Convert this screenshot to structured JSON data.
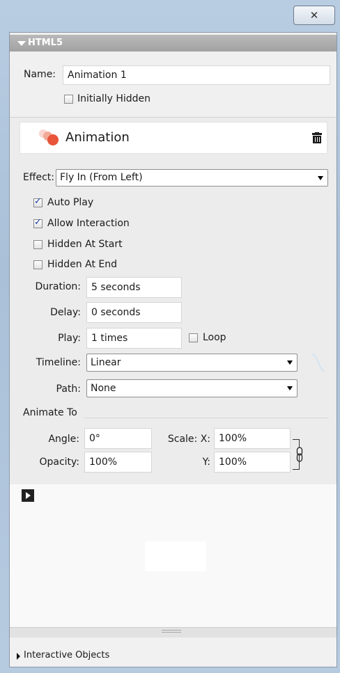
{
  "window": {
    "close_glyph": "✕"
  },
  "html5_section": {
    "title": "HTML5",
    "name_label": "Name:",
    "name_value": "Animation 1",
    "initially_hidden_label": "Initially Hidden",
    "initially_hidden_checked": false
  },
  "animation": {
    "title": "Animation",
    "icon": "animation-dots-icon",
    "delete_icon": "trash-icon",
    "effect_label": "Effect:",
    "effect_value": "Fly In (From Left)",
    "options": [
      {
        "label": "Auto Play",
        "checked": true
      },
      {
        "label": "Allow Interaction",
        "checked": true
      },
      {
        "label": "Hidden At Start",
        "checked": false
      },
      {
        "label": "Hidden At End",
        "checked": false
      }
    ],
    "duration_label": "Duration:",
    "duration_value": "5 seconds",
    "delay_label": "Delay:",
    "delay_value": "0 seconds",
    "play_label": "Play:",
    "play_value": "1 times",
    "loop_label": "Loop",
    "loop_checked": false,
    "timeline_label": "Timeline:",
    "timeline_value": "Linear",
    "path_label": "Path:",
    "path_value": "None",
    "animate_to_heading": "Animate To",
    "angle_label": "Angle:",
    "angle_value": "0°",
    "scale_x_label": "Scale: X:",
    "scale_x_value": "100%",
    "opacity_label": "Opacity:",
    "opacity_value": "100%",
    "scale_y_label": "Y:",
    "scale_y_value": "100%"
  },
  "footer": {
    "interactive_objects_label": "Interactive Objects"
  },
  "colors": {
    "accent_red": "#e8553a",
    "curve_color": "#cfe2f3"
  }
}
